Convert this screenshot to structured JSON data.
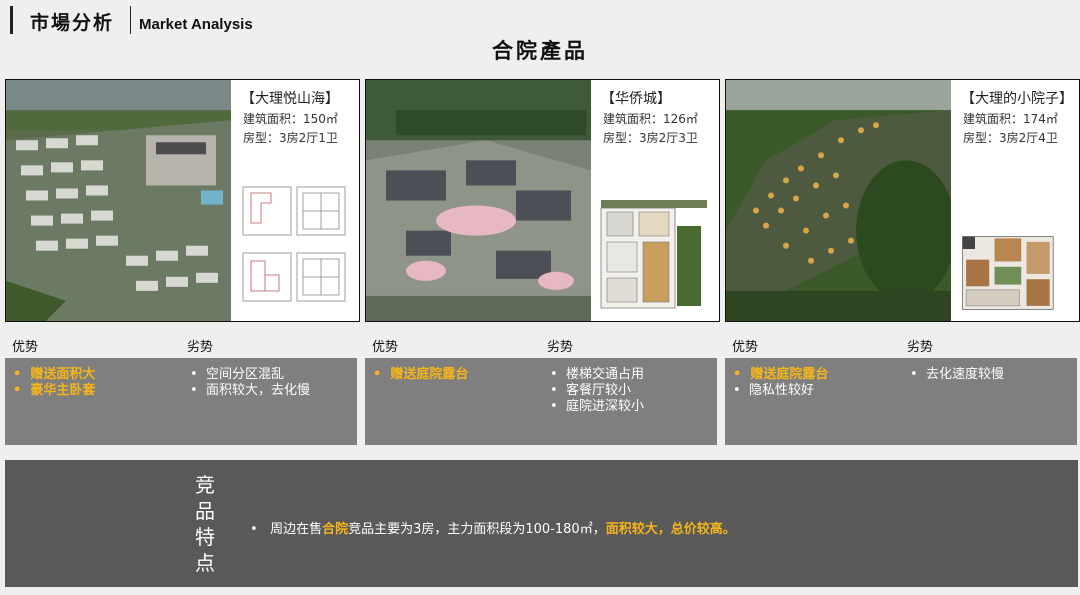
{
  "header": {
    "title_cn": "市場分析",
    "title_en": "Market Analysis"
  },
  "page_title": "合院產品",
  "projects": [
    {
      "name": "【大理悦山海】",
      "area": "建筑面积：150㎡",
      "layout": "房型：3房2厅1卫"
    },
    {
      "name": "【华侨城】",
      "area": "建筑面积：126㎡",
      "layout": "房型：3房2厅3卫"
    },
    {
      "name": "【大理的小院子】",
      "area": "建筑面积：174㎡",
      "layout": "房型：3房2厅4卫"
    }
  ],
  "labels": {
    "pros": "优势",
    "cons": "劣势"
  },
  "analysis": [
    {
      "pros": [
        {
          "text": "赠送面积大",
          "hl": true
        },
        {
          "text": "豪华主卧套",
          "hl": true
        }
      ],
      "cons": [
        "空间分区混乱",
        "面积较大，去化慢"
      ]
    },
    {
      "pros": [
        {
          "text": "赠送庭院露台",
          "hl": true
        }
      ],
      "cons": [
        "楼梯交通占用",
        "客餐厅较小",
        "庭院进深较小"
      ]
    },
    {
      "pros": [
        {
          "text": "赠送庭院露台",
          "hl": true
        },
        {
          "text": "隐私性较好",
          "hl": false
        }
      ],
      "cons": [
        "去化速度较慢"
      ]
    }
  ],
  "summary": {
    "title": "竞品特点",
    "t1": "周边在售",
    "t2": "合院",
    "t3": "竞品主要为3房，主力面积段为100-180㎡，",
    "t4": "面积较大，总价较高。"
  },
  "colors": {
    "highlight": "#f4b41a",
    "panel": "#7f7f7f",
    "bottom_panel": "#595959"
  }
}
